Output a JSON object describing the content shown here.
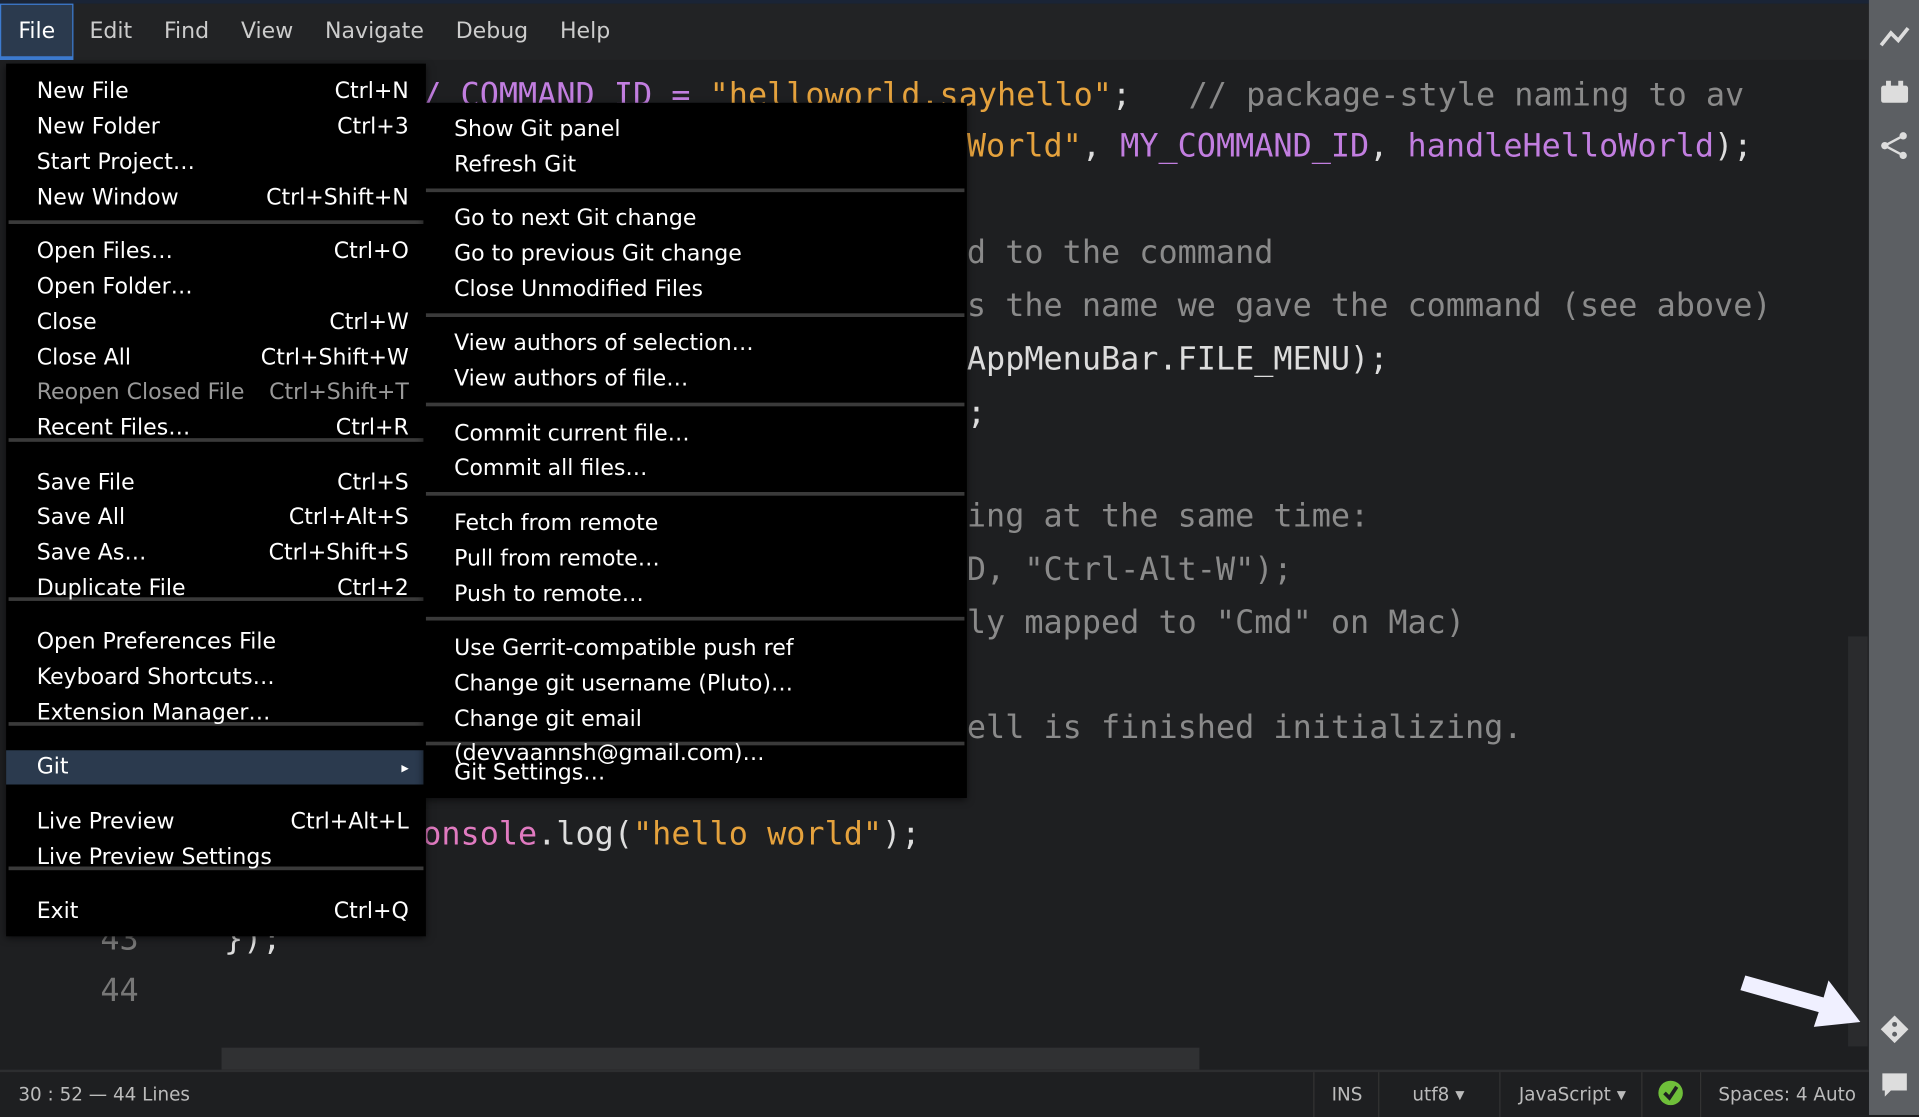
{
  "menubar": {
    "items": [
      "File",
      "Edit",
      "Find",
      "View",
      "Navigate",
      "Debug",
      "Help"
    ],
    "active": "File"
  },
  "file_menu": [
    {
      "label": "New File",
      "shortcut": "Ctrl+N"
    },
    {
      "label": "New Folder",
      "shortcut": "Ctrl+3"
    },
    {
      "label": "Start Project…",
      "shortcut": ""
    },
    {
      "label": "New Window",
      "shortcut": "Ctrl+Shift+N"
    },
    {
      "label": "Open Files…",
      "shortcut": "Ctrl+O"
    },
    {
      "label": "Open Folder…",
      "shortcut": ""
    },
    {
      "label": "Close",
      "shortcut": "Ctrl+W"
    },
    {
      "label": "Close All",
      "shortcut": "Ctrl+Shift+W"
    },
    {
      "label": "Reopen Closed File",
      "shortcut": "Ctrl+Shift+T"
    },
    {
      "label": "Recent Files…",
      "shortcut": "Ctrl+R"
    },
    {
      "label": "Save File",
      "shortcut": "Ctrl+S"
    },
    {
      "label": "Save All",
      "shortcut": "Ctrl+Alt+S"
    },
    {
      "label": "Save As…",
      "shortcut": "Ctrl+Shift+S"
    },
    {
      "label": "Duplicate File",
      "shortcut": "Ctrl+2"
    },
    {
      "label": "Open Preferences File",
      "shortcut": ""
    },
    {
      "label": "Keyboard Shortcuts…",
      "shortcut": ""
    },
    {
      "label": "Extension Manager…",
      "shortcut": ""
    },
    {
      "label": "Git",
      "shortcut": "▸"
    },
    {
      "label": "Live Preview",
      "shortcut": "Ctrl+Alt+L"
    },
    {
      "label": "Live Preview Settings",
      "shortcut": ""
    },
    {
      "label": "Exit",
      "shortcut": "Ctrl+Q"
    }
  ],
  "git_menu": [
    "Show Git panel",
    "Refresh Git",
    "Go to next Git change",
    "Go to previous Git change",
    "Close Unmodified Files",
    "View authors of selection…",
    "View authors of file…",
    "Commit current file…",
    "Commit all files…",
    "Fetch from remote",
    "Pull from remote…",
    "Push to remote…",
    "Use Gerrit-compatible push ref",
    "Change git username (Pluto)…",
    "Change git email (devvaannsh@gmail.com)…",
    "Git Settings…"
  ],
  "code": {
    "l1a": "/ COMMAND_ID = ",
    "l1b": "\"helloworld.sayhello\"",
    "l1c": ";   ",
    "l1d": "// package-style naming to av",
    "l2a": "World\"",
    "l2b": ", ",
    "l2c": "MY_COMMAND_ID",
    "l2d": ", ",
    "l2e": "handleHelloWorld",
    "l2f": ");",
    "l3": "d to the command",
    "l4": "s the name we gave the command (see above)",
    "l5": "AppMenuBar.FILE_MENU);",
    "l6": ";",
    "l7": "ing at the same time:",
    "l8a": "D, ",
    "l8b": "\"Ctrl-Alt-W\"",
    "l8c": ");",
    "l9": "ly mapped to \"Cmd\" on Mac)",
    "l10": "ell is finished initializing.",
    "l11a": "onsole",
    "l11b": ".log(",
    "l11c": "\"hello world\"",
    "l11d": ");",
    "n43": "43",
    "l43": "});",
    "n44": "44"
  },
  "status": {
    "position": "30 : 52 — 44 Lines",
    "mode": "INS",
    "encoding": "utf8",
    "language": "JavaScript",
    "spaces": "Spaces:  4  Auto"
  }
}
